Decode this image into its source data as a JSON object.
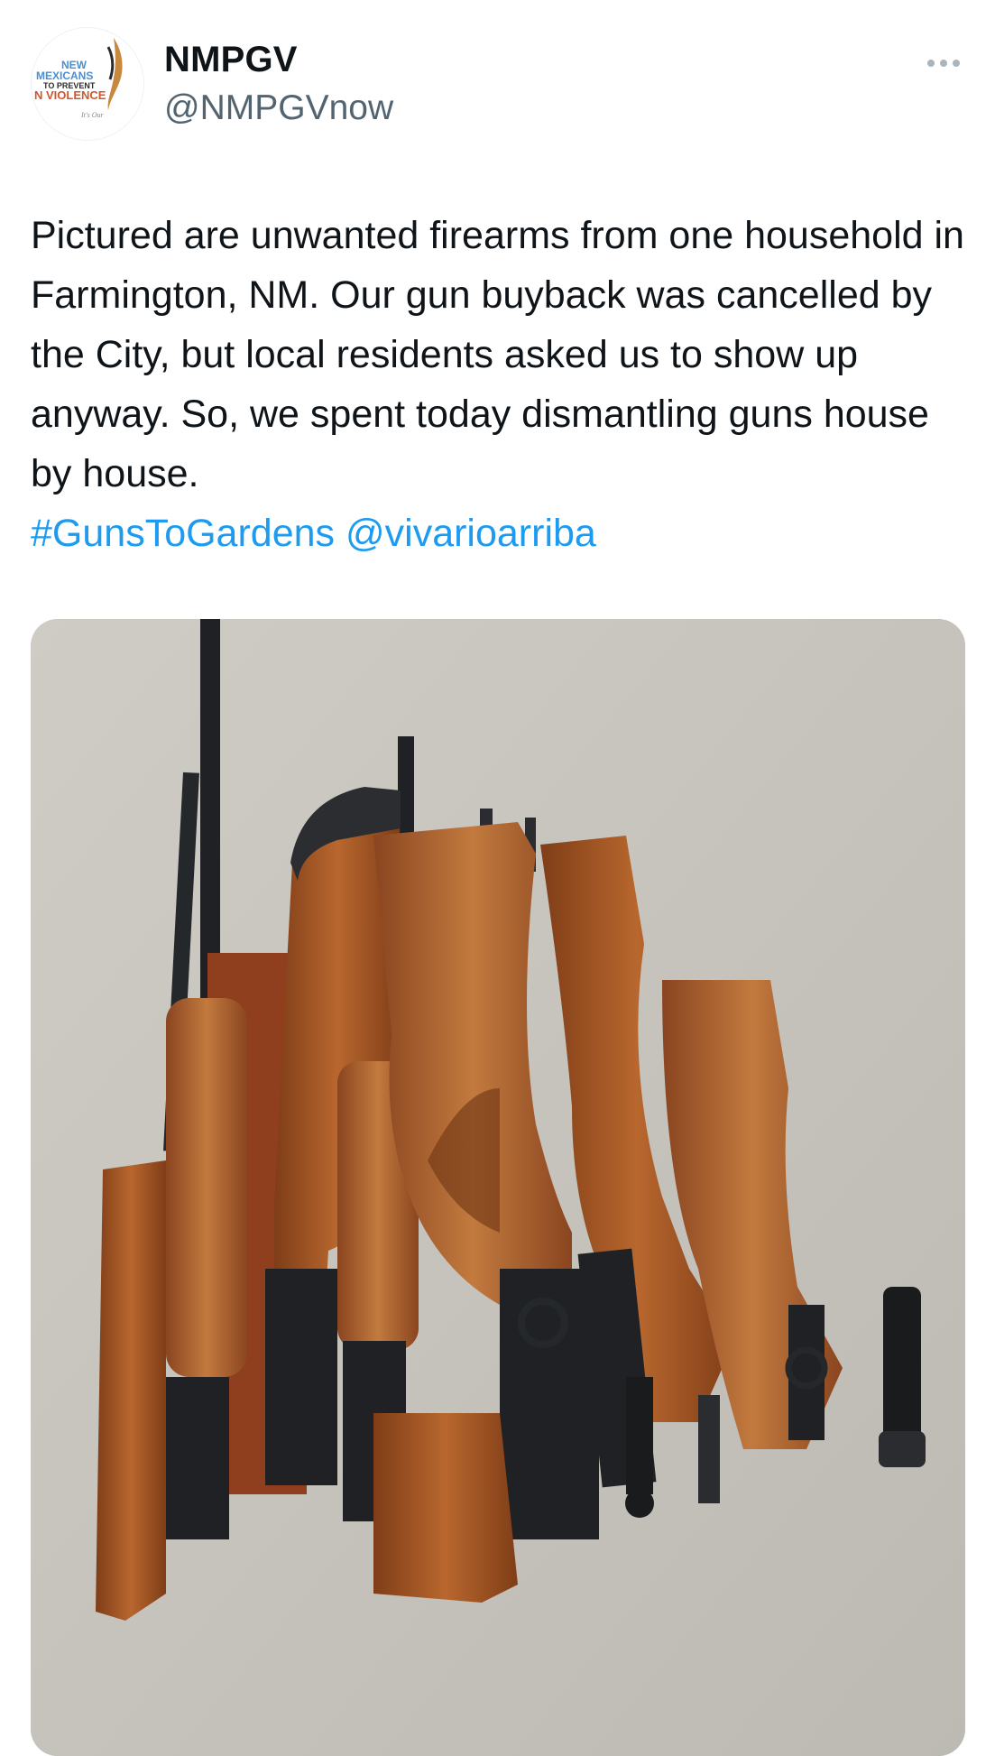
{
  "tweet": {
    "author": {
      "display_name": "NMPGV",
      "handle": "@NMPGVnow",
      "avatar_logo_lines": [
        "NEW",
        "MEXICANS",
        "TO PREVENT",
        "N VIOLENCE",
        "It's Our"
      ]
    },
    "more_icon": "more-horizontal-icon",
    "text_body": "Pictured are unwanted firearms from one household in Farmington, NM.  Our gun buyback was cancelled by the City, but local residents asked us to show up anyway. So, we spent today dismantling guns house by house.",
    "hashtag": "#GunsToGardens",
    "mention": "@vivarioarriba",
    "media": {
      "description_icon": "photo",
      "colors": {
        "concrete": "#c7c3bd",
        "wood": "#9a4f22",
        "wood_light": "#b8672e",
        "metal": "#1f2124"
      }
    }
  },
  "colors": {
    "text": "#0f1419",
    "secondary": "#536471",
    "link": "#1d9bf0"
  }
}
